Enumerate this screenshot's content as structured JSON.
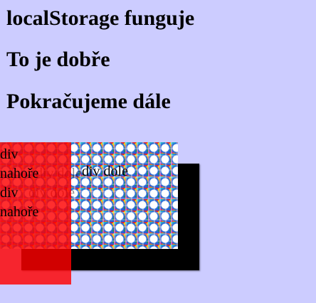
{
  "headings": {
    "storage": "localStorage funguje",
    "dobre": "To je dobře",
    "dale": "Pokračujeme dále"
  },
  "labels": {
    "div": "div",
    "nahore": "nahoře",
    "div_dole": "div dole"
  },
  "colors": {
    "background": "#ccccff",
    "red_box": "#ff0000",
    "black_box": "#000000"
  }
}
